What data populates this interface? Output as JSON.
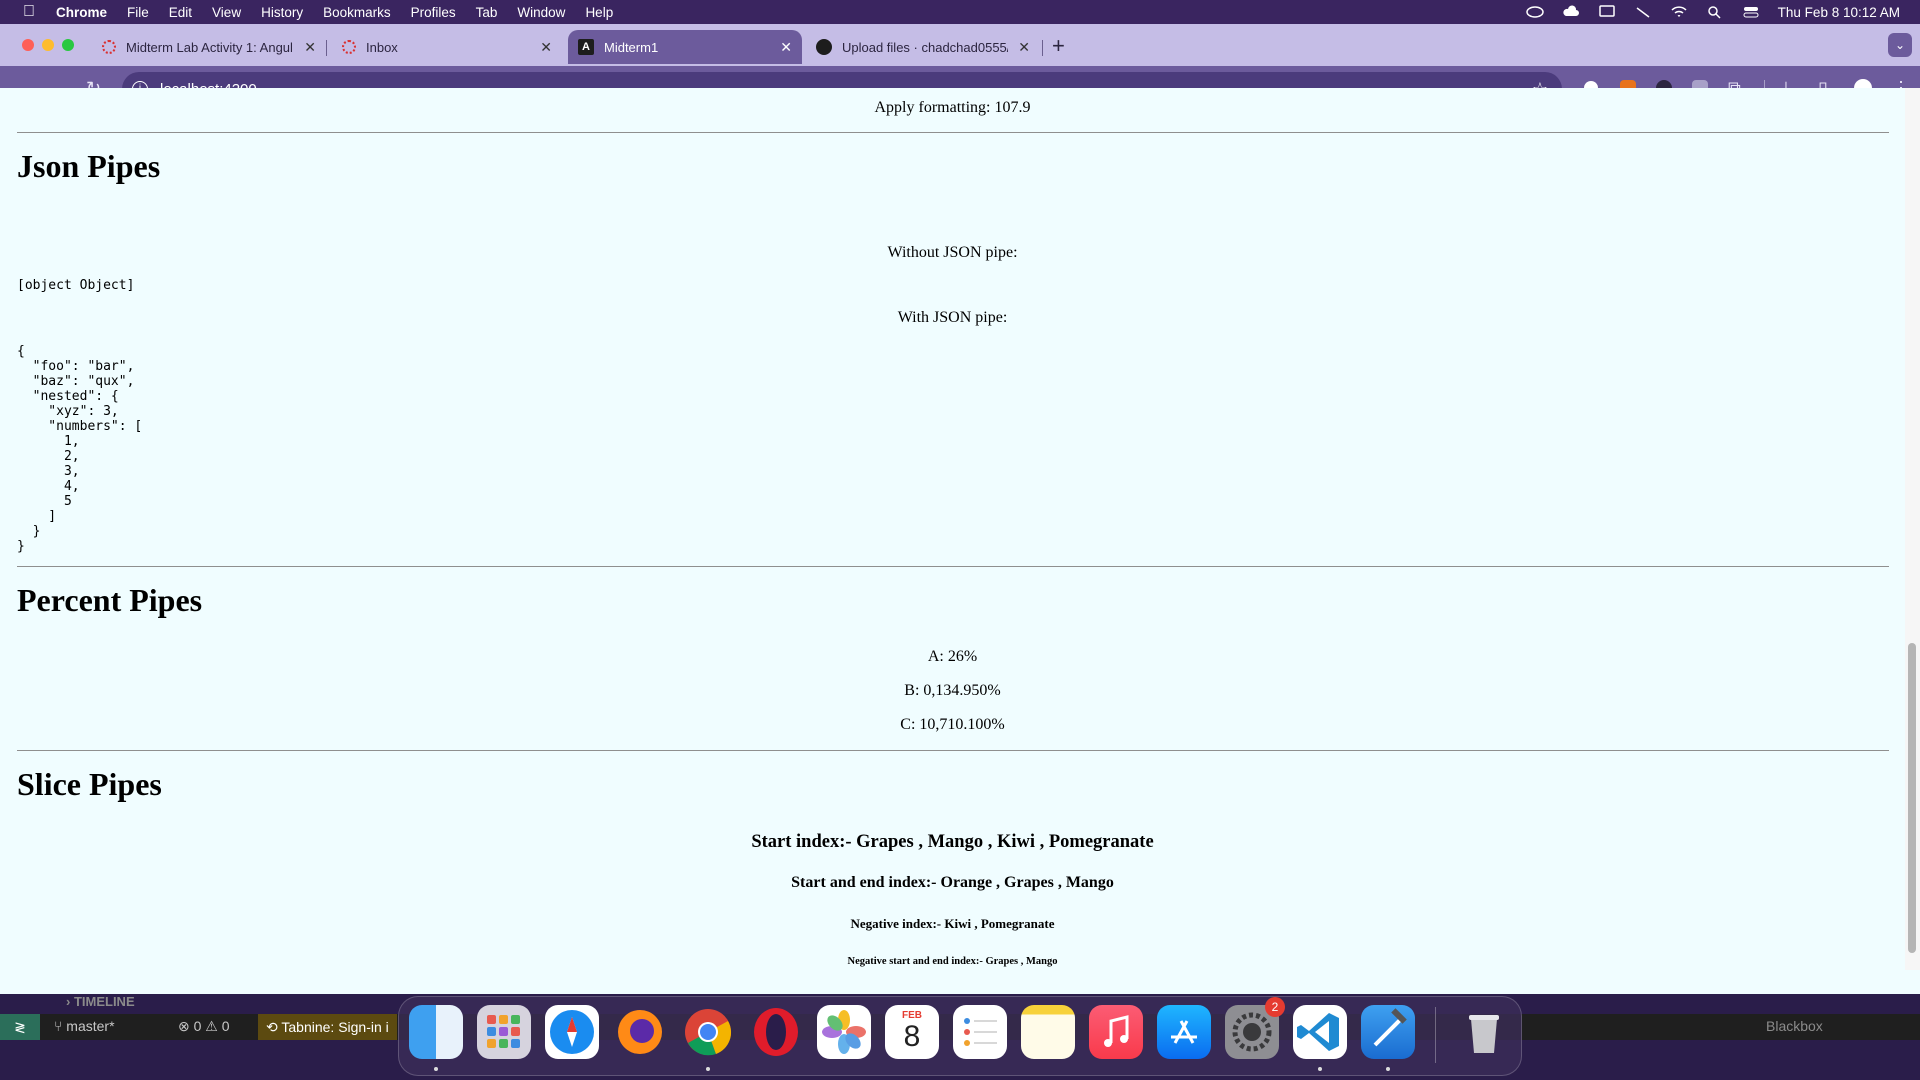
{
  "menubar": {
    "app": "Chrome",
    "items": [
      "File",
      "Edit",
      "View",
      "History",
      "Bookmarks",
      "Profiles",
      "Tab",
      "Window",
      "Help"
    ],
    "clock": "Thu Feb 8  10:12 AM"
  },
  "tabs": [
    {
      "title": "Midterm Lab Activity 1: Angul"
    },
    {
      "title": "Inbox"
    },
    {
      "title": "Midterm1"
    },
    {
      "title": "Upload files · chadchad0555/"
    }
  ],
  "address": {
    "url": "localhost:4200"
  },
  "page": {
    "apply_formatting": "Apply formatting: 107.9",
    "json_heading": "Json Pipes",
    "without_json": "Without JSON pipe:",
    "object_text": "[object Object]",
    "with_json": "With JSON pipe:",
    "json_output": "{\n  \"foo\": \"bar\",\n  \"baz\": \"qux\",\n  \"nested\": {\n    \"xyz\": 3,\n    \"numbers\": [\n      1,\n      2,\n      3,\n      4,\n      5\n    ]\n  }\n}",
    "percent_heading": "Percent Pipes",
    "percent_a": "A: 26%",
    "percent_b": "B: 0,134.950%",
    "percent_c": "C: 10,710.100%",
    "slice_heading": "Slice Pipes",
    "slice_start": "Start index:- Grapes , Mango , Kiwi , Pomegranate",
    "slice_start_end": "Start and end index:- Orange , Grapes , Mango",
    "slice_negative": "Negative index:- Kiwi , Pomegranate",
    "slice_negative_start_end": "Negative start and end index:- Grapes , Mango"
  },
  "vscode": {
    "timeline": "TIMELINE",
    "branch": "master*",
    "problems": "0 ⚠ 0",
    "tabnine": "Tabnine: Sign-in i",
    "blackbox": "Blackbox"
  },
  "dock": {
    "calendar_month": "FEB",
    "calendar_day": "8",
    "settings_badge": "2"
  }
}
